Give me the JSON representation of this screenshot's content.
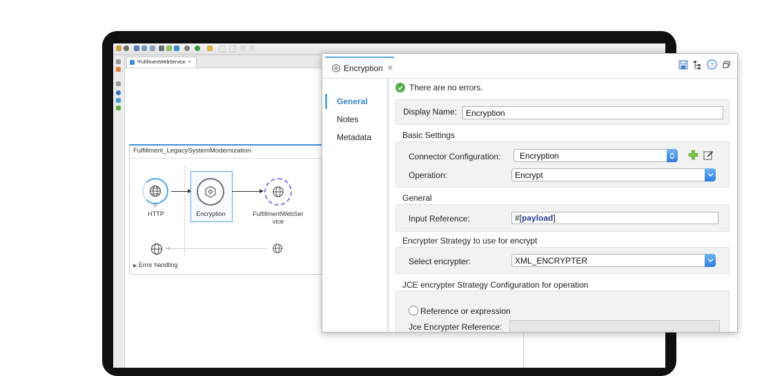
{
  "ide": {
    "editor_tab": "*FufillmentWebService",
    "flow_title": "Fulfillment_LegacySystemModernization",
    "nodes": [
      {
        "label": "HTTP",
        "icon": "globe-icon"
      },
      {
        "label": "Encryption",
        "icon": "encryption-icon"
      },
      {
        "label": "FulfillmentWebSer\nvice",
        "icon": "soap-globe-icon"
      }
    ],
    "error_handling": "Error handling",
    "colors": {
      "accent": "#3e8ddd",
      "node_ring": "#4aa3e4",
      "soap_ring": "#7a7ae8"
    }
  },
  "dialog": {
    "tab_label": "Encryption",
    "close_glyph": "✕",
    "nav": [
      "General",
      "Notes",
      "Metadata"
    ],
    "status_text": "There are no errors.",
    "display_name_label": "Display Name:",
    "display_name_value": "Encryption",
    "basic_settings": {
      "heading": "Basic Settings",
      "connector_label": "Connector Configuration:",
      "connector_value": "Encryption",
      "operation_label": "Operation:",
      "operation_value": "Encrypt"
    },
    "general": {
      "heading": "General",
      "input_ref_label": "Input Reference:",
      "input_ref_prefix": "#[",
      "input_ref_keyword": "payload",
      "input_ref_suffix": "]"
    },
    "strategy": {
      "heading": "Encrypter Strategy to use for encrypt",
      "select_label": "Select encrypter:",
      "select_value": "XML_ENCRYPTER"
    },
    "jce": {
      "heading": "JCE encrypter Strategy Configuration for operation",
      "radio_label": "Reference or expression",
      "ref_label": "Jce Encrypter Reference:"
    }
  }
}
